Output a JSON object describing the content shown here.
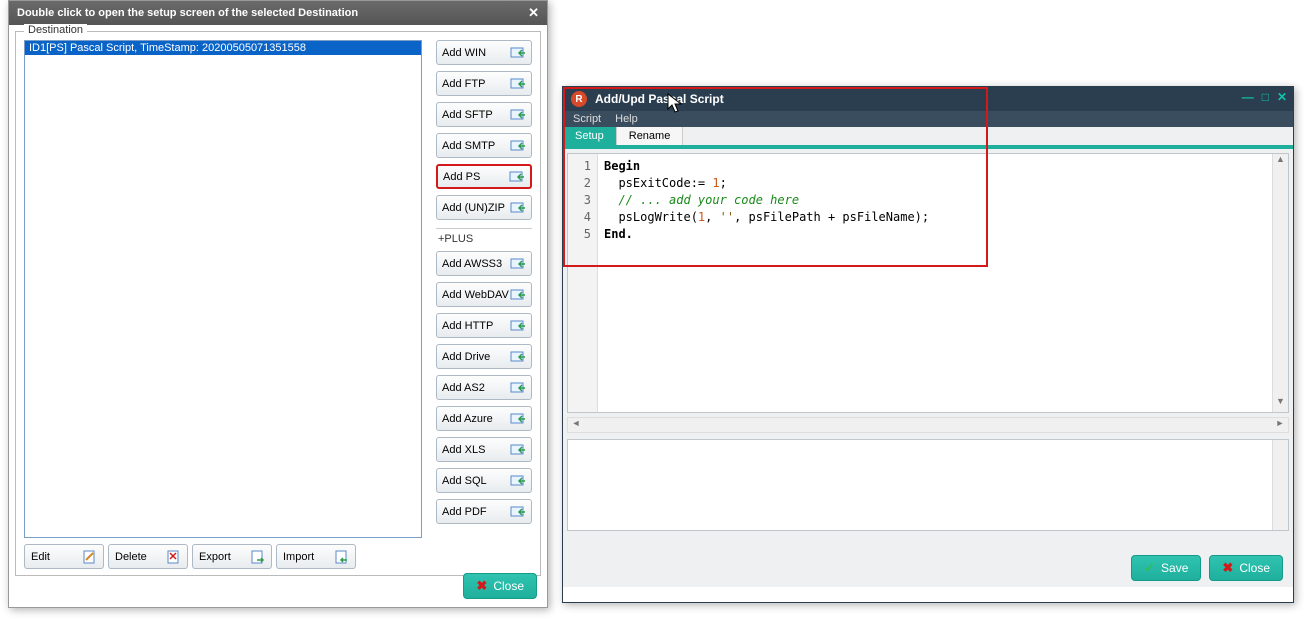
{
  "dest": {
    "titlebar": "Double click to open the setup screen of the selected Destination",
    "legend": "Destination",
    "item": "ID1[PS] Pascal Script, TimeStamp: 20200505071351558",
    "buttons": [
      "Add WIN",
      "Add FTP",
      "Add SFTP",
      "Add SMTP",
      "Add PS",
      "Add (UN)ZIP"
    ],
    "plus_label": "+PLUS",
    "plus_buttons": [
      "Add AWSS3",
      "Add WebDAV",
      "Add HTTP",
      "Add Drive",
      "Add AS2",
      "Add Azure",
      "Add XLS",
      "Add SQL",
      "Add PDF"
    ],
    "actions": {
      "edit": "Edit",
      "delete": "Delete",
      "export": "Export",
      "import": "Import"
    },
    "close": "Close"
  },
  "script": {
    "title": "Add/Upd Pascal Script",
    "menu": {
      "script": "Script",
      "help": "Help"
    },
    "tabs": {
      "setup": "Setup",
      "rename": "Rename"
    },
    "code": {
      "l1": "Begin",
      "l2a": "  psExitCode:= ",
      "l2b": "1",
      "l2c": ";",
      "l3a": "  ",
      "l3b": "// ... add your code here",
      "l4a": "  psLogWrite(",
      "l4b": "1",
      "l4c": ", ",
      "l4d": "''",
      "l4e": ", psFilePath + psFileName);",
      "l5": "End."
    },
    "lines": [
      "1",
      "2",
      "3",
      "4",
      "5"
    ],
    "save": "Save",
    "close": "Close"
  },
  "colors": {
    "teal": "#1fb09d",
    "red": "#d21a1a",
    "select": "#0a64c8"
  }
}
